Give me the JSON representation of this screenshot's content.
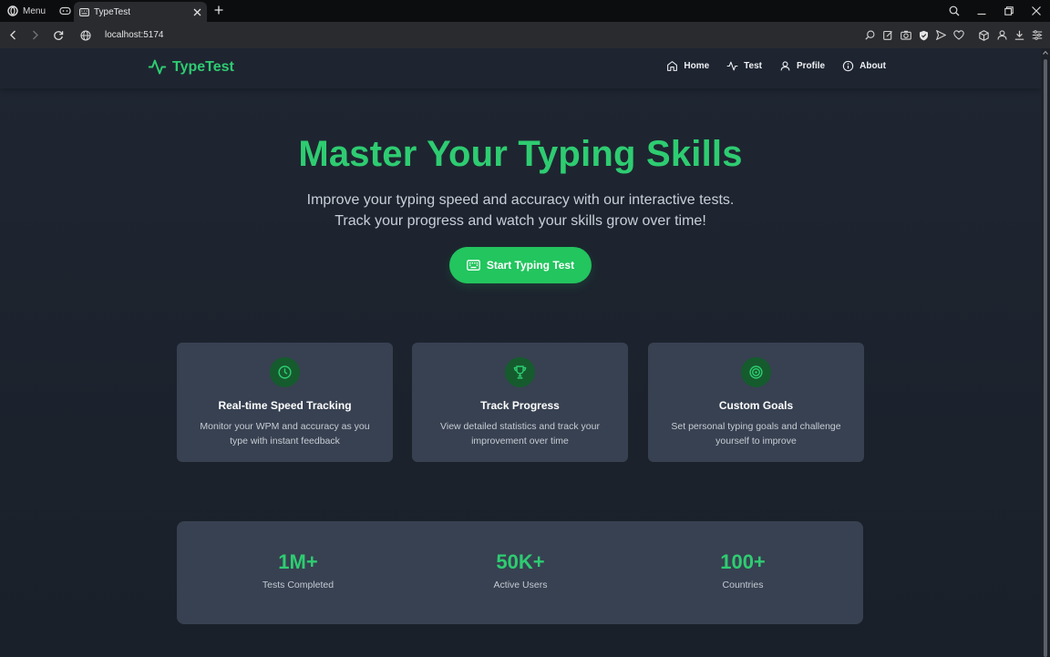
{
  "browser": {
    "menu_label": "Menu",
    "tab_title": "TypeTest",
    "url": "localhost:5174"
  },
  "header": {
    "logo": "TypeTest",
    "nav": [
      {
        "label": "Home",
        "icon": "home-icon"
      },
      {
        "label": "Test",
        "icon": "activity-icon"
      },
      {
        "label": "Profile",
        "icon": "user-icon"
      },
      {
        "label": "About",
        "icon": "info-icon"
      }
    ]
  },
  "hero": {
    "title": "Master Your Typing Skills",
    "subtitle": "Improve your typing speed and accuracy with our interactive tests. Track your progress and watch your skills grow over time!",
    "cta_label": "Start Typing Test"
  },
  "features": [
    {
      "icon": "clock-icon",
      "title": "Real-time Speed Tracking",
      "description": "Monitor your WPM and accuracy as you type with instant feedback"
    },
    {
      "icon": "trophy-icon",
      "title": "Track Progress",
      "description": "View detailed statistics and track your improvement over time"
    },
    {
      "icon": "target-icon",
      "title": "Custom Goals",
      "description": "Set personal typing goals and challenge yourself to improve"
    }
  ],
  "stats": [
    {
      "value": "1M+",
      "label": "Tests Completed"
    },
    {
      "value": "50K+",
      "label": "Active Users"
    },
    {
      "value": "100+",
      "label": "Countries"
    }
  ],
  "colors": {
    "accent": "#2ecc71",
    "button": "#22c55e",
    "card_bg": "#374151",
    "page_bg": "#1c222c"
  }
}
